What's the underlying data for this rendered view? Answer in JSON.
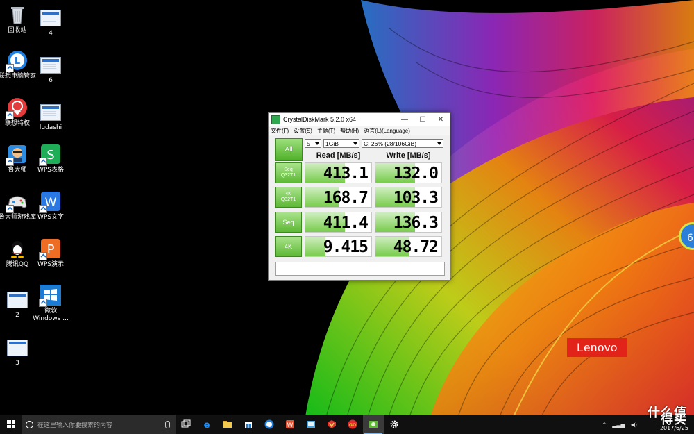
{
  "desktop": {
    "icons": [
      {
        "label": "回收站",
        "icon": "recycle-bin-icon"
      },
      {
        "label": "4",
        "icon": "document-icon"
      },
      {
        "label": "联想电脑管家",
        "icon": "lenovo-pc-manager-icon"
      },
      {
        "label": "6",
        "icon": "document-icon"
      },
      {
        "label": "联想特权",
        "icon": "lenovo-privilege-icon"
      },
      {
        "label": "ludashi",
        "icon": "document-icon"
      },
      {
        "label": "鲁大师",
        "icon": "ludashi-icon"
      },
      {
        "label": "WPS表格",
        "icon": "wps-spreadsheet-icon"
      },
      {
        "label": "鲁大师游戏库",
        "icon": "ludashi-game-icon"
      },
      {
        "label": "WPS文字",
        "icon": "wps-writer-icon"
      },
      {
        "label": "腾讯QQ",
        "icon": "qq-icon"
      },
      {
        "label": "WPS演示",
        "icon": "wps-presentation-icon"
      },
      {
        "label": "2",
        "icon": "document-icon"
      },
      {
        "label": "微软",
        "label2": "Windows ...",
        "icon": "windows-icon"
      },
      {
        "label": "3",
        "icon": "document-icon"
      }
    ],
    "brand_logo": "Lenovo",
    "side_widget": "6"
  },
  "cdm": {
    "title": "CrystalDiskMark 5.2.0 x64",
    "window_controls": {
      "minimize": "—",
      "maximize": "☐",
      "close": "✕"
    },
    "menu": [
      "文件(F)",
      "设置(S)",
      "主题(T)",
      "帮助(H)",
      "语言(L)(Language)"
    ],
    "all_button": "All",
    "count_select": "5",
    "size_select": "1GiB",
    "drive_select": "C: 26% (28/106GiB)",
    "read_header": "Read [MB/s]",
    "write_header": "Write [MB/s]",
    "rows": [
      {
        "label1": "Seq",
        "label2": "Q32T1",
        "read": "413.1",
        "write": "132.0",
        "read_level": 0.6,
        "write_level": 0.6
      },
      {
        "label1": "4K",
        "label2": "Q32T1",
        "read": "168.7",
        "write": "103.3",
        "read_level": 0.5,
        "write_level": 0.6
      },
      {
        "label1": "Seq",
        "label2": "",
        "read": "411.4",
        "write": "136.3",
        "read_level": 0.6,
        "write_level": 0.6
      },
      {
        "label1": "4K",
        "label2": "",
        "read": "9.415",
        "write": "48.72",
        "read_level": 0.3,
        "write_level": 0.5
      }
    ],
    "accent": "#5db834"
  },
  "taskbar": {
    "search_placeholder": "在这里输入你要搜索的内容",
    "apps": [
      "task-view-icon",
      "edge-icon",
      "file-explorer-icon",
      "store-icon",
      "lenovo-manager-icon",
      "wps-icon",
      "photos-icon",
      "ludashi-icon",
      "game-icon",
      "crystaldiskmark-icon",
      "settings-icon"
    ],
    "tray_ime_text": "什么值得买",
    "date": "2017/6/25"
  }
}
